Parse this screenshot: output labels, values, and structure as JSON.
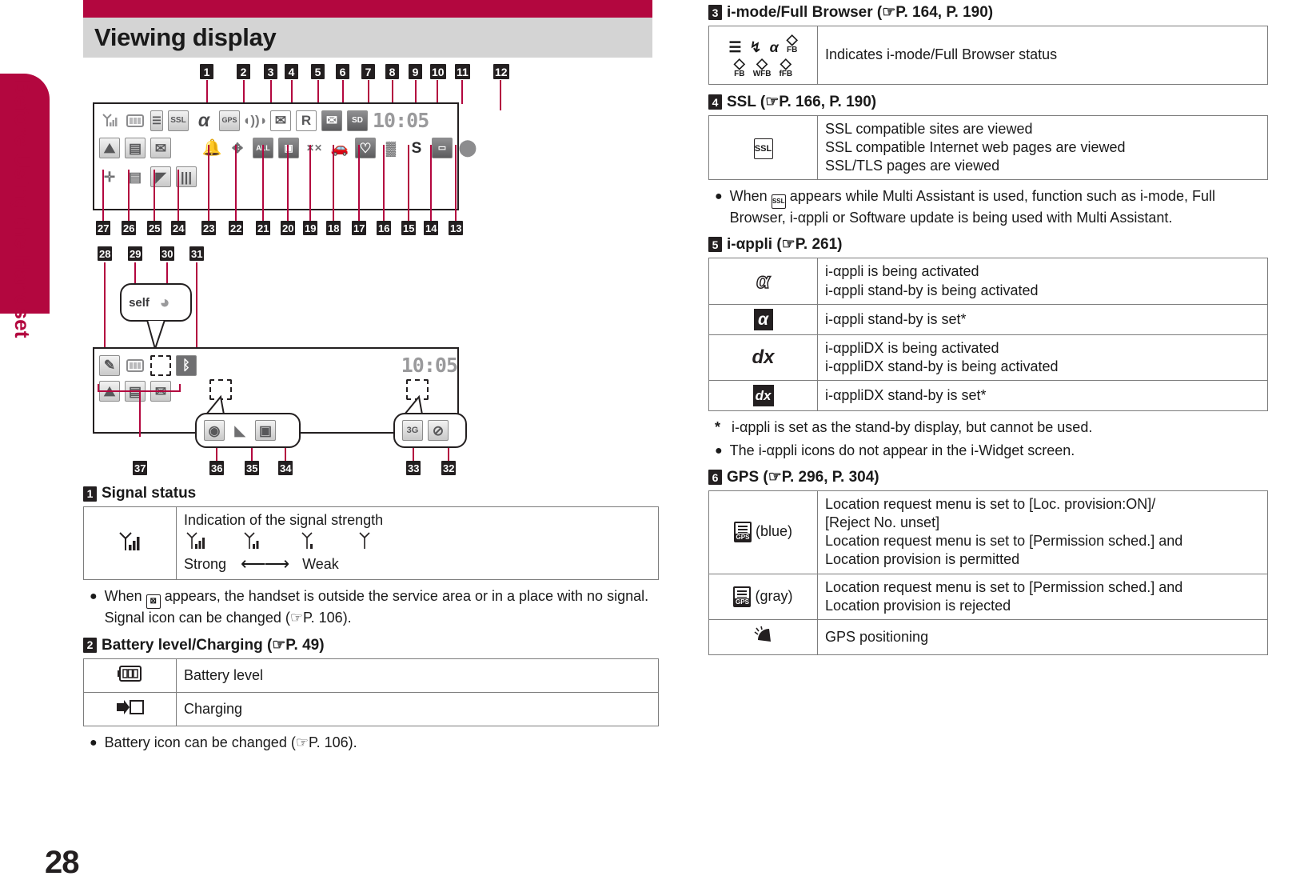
{
  "sidebar": {
    "chapter_label": "Before Using the Handset"
  },
  "footer": {
    "page_number": "28"
  },
  "header": {
    "title": "Viewing display"
  },
  "diagram": {
    "top_callouts": [
      "1",
      "2",
      "3",
      "4",
      "5",
      "6",
      "7",
      "8",
      "9",
      "10",
      "11",
      "12"
    ],
    "bottom_callouts": [
      "27",
      "26",
      "25",
      "24",
      "23",
      "22",
      "21",
      "20",
      "19",
      "18",
      "17",
      "16",
      "15",
      "14",
      "13"
    ],
    "bubble_callouts": [
      "28",
      "29",
      "30",
      "31"
    ],
    "sub_callouts": [
      "37",
      "36",
      "35",
      "34",
      "33",
      "32"
    ],
    "screen1": {
      "clock": "10:05",
      "row1_icons": [
        "signal-icon",
        "battery-icon",
        "i-mode-icon",
        "ssl-icon",
        "i-appli-icon",
        "gps-icon",
        "sound-icon",
        "mail-icon",
        "roaming-icon",
        "mail-folder-icon",
        "sd-card-icon"
      ],
      "row2_icons": [
        "image-icon",
        "data-icon",
        "mail-box-icon",
        "alarm-icon",
        "multitask-icon",
        "all-lock-icon",
        "ic-card-lock-icon",
        "mute-icon",
        "drive-mode-icon",
        "heart-icon",
        "vibrator-icon",
        "osaifu-icon",
        "record-icon",
        "moon-icon"
      ],
      "row3_icons": [
        "usb-icon",
        "pc-movie-icon",
        "quick-record-icon",
        "memory-icon"
      ]
    },
    "bubble1_icons": [
      "self-mode-icon",
      "public-mode-icon"
    ],
    "screen2": {
      "clock": "10:05",
      "row1_icons": [
        "note-off-icon",
        "battery-icon",
        "dashed-slot-icon",
        "bluetooth-icon"
      ],
      "row2_icons": [
        "image-icon",
        "data-icon",
        "mail-box-icon"
      ],
      "bubble_left_icons": [
        "camera-icon",
        "origami-icon",
        "qr-icon"
      ],
      "bubble_right_icons": [
        "3g-icon",
        "no-signal-icon"
      ]
    }
  },
  "sections": [
    {
      "number": "1",
      "title": "Signal status",
      "ref": "",
      "kind": "signal",
      "table": {
        "icon": "signal-icon",
        "heading": "Indication of the signal strength",
        "levels": [
          "signal-4-icon",
          "signal-3-icon",
          "signal-2-icon",
          "signal-1-icon"
        ],
        "strong_label": "Strong",
        "weak_label": "Weak"
      },
      "notes": [
        {
          "marker": "dot",
          "text_before": "When",
          "glyph": "out-of-area-icon",
          "text_after": "appears, the handset is outside the service area or in a place with no signal. Signal icon can be changed (☞P. 106)."
        }
      ]
    },
    {
      "number": "2",
      "title": "Battery level/Charging (☞P. 49)",
      "rows": [
        {
          "icon": "battery-icon",
          "desc": [
            "Battery level"
          ]
        },
        {
          "icon": "charging-icon",
          "desc": [
            "Charging"
          ]
        }
      ],
      "notes": [
        {
          "marker": "dot",
          "text_before": "",
          "glyph": "",
          "text_after": "Battery icon can be changed (☞P. 106)."
        }
      ]
    },
    {
      "number": "3",
      "title": "i-mode/Full Browser (☞P. 164, P. 190)",
      "rows": [
        {
          "icon": "i-mode-fb-glyph-set",
          "desc": [
            "Indicates i-mode/Full Browser status"
          ]
        }
      ],
      "glyph_set": {
        "row1": [
          {
            "main": "☰",
            "sub": ""
          },
          {
            "main": "↯",
            "sub": ""
          },
          {
            "main": "α",
            "sub": ""
          },
          {
            "main": "◇",
            "sub": "FB"
          }
        ],
        "row2": [
          {
            "main": "◇",
            "sub": "FB"
          },
          {
            "main": "◇",
            "sub": "WFB"
          },
          {
            "main": "◇",
            "sub": "fFB"
          }
        ]
      }
    },
    {
      "number": "4",
      "title": "SSL (☞P. 166, P. 190)",
      "rows": [
        {
          "icon": "ssl-icon",
          "desc": [
            "SSL compatible sites are viewed",
            "SSL compatible Internet web pages are viewed",
            "SSL/TLS pages are viewed"
          ]
        }
      ],
      "notes": [
        {
          "marker": "dot",
          "text_before": "When",
          "glyph": "ssl-icon",
          "text_after": "appears while Multi Assistant is used, function such as i-mode, Full Browser, i-αppli or Software update is being used with Multi Assistant."
        }
      ]
    },
    {
      "number": "5",
      "title": "i-αppli (☞P. 261)",
      "rows": [
        {
          "icon": "i-appli-active-icon",
          "desc": [
            "i-αppli is being activated",
            "i-αppli stand-by is being activated"
          ]
        },
        {
          "icon": "i-appli-standby-icon",
          "desc": [
            "i-αppli stand-by is set*"
          ]
        },
        {
          "icon": "i-appli-dx-active-icon",
          "desc": [
            "i-αppliDX is being activated",
            "i-αppliDX stand-by is being activated"
          ]
        },
        {
          "icon": "i-appli-dx-standby-icon",
          "desc": [
            "i-αppliDX stand-by is set*"
          ]
        }
      ],
      "notes": [
        {
          "marker": "star",
          "text_before": "",
          "glyph": "",
          "text_after": "i-αppli is set as the stand-by display, but cannot be used."
        },
        {
          "marker": "dot",
          "text_before": "",
          "glyph": "",
          "text_after": "The i-αppli icons do not appear in the i-Widget screen."
        }
      ]
    },
    {
      "number": "6",
      "title": "GPS (☞P. 296, P. 304)",
      "rows": [
        {
          "icon": "gps-icon",
          "icon_suffix": "(blue)",
          "desc": [
            "Location request menu is set to [Loc. provision:ON]/",
            "[Reject No. unset]",
            "Location request menu is set to [Permission sched.] and",
            "Location provision is permitted"
          ]
        },
        {
          "icon": "gps-icon",
          "icon_suffix": "(gray)",
          "desc": [
            "Location request menu is set to [Permission sched.] and",
            "Location provision is rejected"
          ]
        },
        {
          "icon": "gps-positioning-icon",
          "icon_suffix": "",
          "desc": [
            "GPS positioning"
          ]
        }
      ]
    }
  ],
  "colors": {
    "brand": "#b3073f",
    "title_band": "#d4d4d4",
    "chip": "#231f20"
  }
}
